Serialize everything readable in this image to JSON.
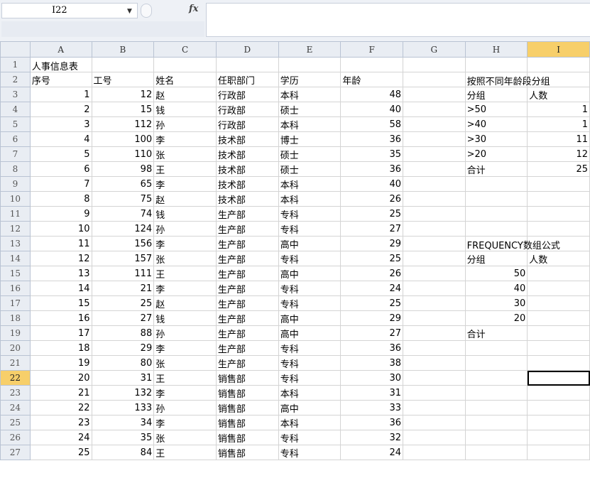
{
  "formula_bar": {
    "name_box": "I22",
    "fx": "fx",
    "formula": ""
  },
  "columns": [
    "A",
    "B",
    "C",
    "D",
    "E",
    "F",
    "G",
    "H",
    "I"
  ],
  "active_column": "I",
  "active_row": "22",
  "rows": [
    {
      "n": "1",
      "A": "人事信息表",
      "B": "",
      "C": "",
      "D": "",
      "E": "",
      "F": "",
      "G": "",
      "H": "",
      "I": ""
    },
    {
      "n": "2",
      "A": "序号",
      "B": "工号",
      "C": "姓名",
      "D": "任职部门",
      "E": "学历",
      "F": "年龄",
      "G": "",
      "H": "按照不同年龄段分组",
      "I": ""
    },
    {
      "n": "3",
      "A": "1",
      "B": "12",
      "C": "赵",
      "D": "行政部",
      "E": "本科",
      "F": "48",
      "G": "",
      "H": "分组",
      "I": "人数"
    },
    {
      "n": "4",
      "A": "2",
      "B": "15",
      "C": "钱",
      "D": "行政部",
      "E": "硕士",
      "F": "40",
      "G": "",
      "H": ">50",
      "I": "1"
    },
    {
      "n": "5",
      "A": "3",
      "B": "112",
      "C": "孙",
      "D": "行政部",
      "E": "本科",
      "F": "58",
      "G": "",
      "H": ">40",
      "I": "1"
    },
    {
      "n": "6",
      "A": "4",
      "B": "100",
      "C": "李",
      "D": "技术部",
      "E": "博士",
      "F": "36",
      "G": "",
      "H": ">30",
      "I": "11"
    },
    {
      "n": "7",
      "A": "5",
      "B": "110",
      "C": "张",
      "D": "技术部",
      "E": "硕士",
      "F": "35",
      "G": "",
      "H": ">20",
      "I": "12"
    },
    {
      "n": "8",
      "A": "6",
      "B": "98",
      "C": "王",
      "D": "技术部",
      "E": "硕士",
      "F": "36",
      "G": "",
      "H": "合计",
      "I": "25"
    },
    {
      "n": "9",
      "A": "7",
      "B": "65",
      "C": "李",
      "D": "技术部",
      "E": "本科",
      "F": "40",
      "G": "",
      "H": "",
      "I": ""
    },
    {
      "n": "10",
      "A": "8",
      "B": "75",
      "C": "赵",
      "D": "技术部",
      "E": "本科",
      "F": "26",
      "G": "",
      "H": "",
      "I": ""
    },
    {
      "n": "11",
      "A": "9",
      "B": "74",
      "C": "钱",
      "D": "生产部",
      "E": "专科",
      "F": "25",
      "G": "",
      "H": "",
      "I": ""
    },
    {
      "n": "12",
      "A": "10",
      "B": "124",
      "C": "孙",
      "D": "生产部",
      "E": "专科",
      "F": "27",
      "G": "",
      "H": "",
      "I": ""
    },
    {
      "n": "13",
      "A": "11",
      "B": "156",
      "C": "李",
      "D": "生产部",
      "E": "高中",
      "F": "29",
      "G": "",
      "H": "FREQUENCY数组公式",
      "I": ""
    },
    {
      "n": "14",
      "A": "12",
      "B": "157",
      "C": "张",
      "D": "生产部",
      "E": "专科",
      "F": "25",
      "G": "",
      "H": "分组",
      "I": "人数"
    },
    {
      "n": "15",
      "A": "13",
      "B": "111",
      "C": "王",
      "D": "生产部",
      "E": "高中",
      "F": "26",
      "G": "",
      "H": "50",
      "I": ""
    },
    {
      "n": "16",
      "A": "14",
      "B": "21",
      "C": "李",
      "D": "生产部",
      "E": "专科",
      "F": "24",
      "G": "",
      "H": "40",
      "I": ""
    },
    {
      "n": "17",
      "A": "15",
      "B": "25",
      "C": "赵",
      "D": "生产部",
      "E": "专科",
      "F": "25",
      "G": "",
      "H": "30",
      "I": ""
    },
    {
      "n": "18",
      "A": "16",
      "B": "27",
      "C": "钱",
      "D": "生产部",
      "E": "高中",
      "F": "29",
      "G": "",
      "H": "20",
      "I": ""
    },
    {
      "n": "19",
      "A": "17",
      "B": "88",
      "C": "孙",
      "D": "生产部",
      "E": "高中",
      "F": "27",
      "G": "",
      "H": "合计",
      "I": ""
    },
    {
      "n": "20",
      "A": "18",
      "B": "29",
      "C": "李",
      "D": "生产部",
      "E": "专科",
      "F": "36",
      "G": "",
      "H": "",
      "I": ""
    },
    {
      "n": "21",
      "A": "19",
      "B": "80",
      "C": "张",
      "D": "生产部",
      "E": "专科",
      "F": "38",
      "G": "",
      "H": "",
      "I": ""
    },
    {
      "n": "22",
      "A": "20",
      "B": "31",
      "C": "王",
      "D": "销售部",
      "E": "专科",
      "F": "30",
      "G": "",
      "H": "",
      "I": ""
    },
    {
      "n": "23",
      "A": "21",
      "B": "132",
      "C": "李",
      "D": "销售部",
      "E": "本科",
      "F": "31",
      "G": "",
      "H": "",
      "I": ""
    },
    {
      "n": "24",
      "A": "22",
      "B": "133",
      "C": "孙",
      "D": "销售部",
      "E": "高中",
      "F": "33",
      "G": "",
      "H": "",
      "I": ""
    },
    {
      "n": "25",
      "A": "23",
      "B": "34",
      "C": "李",
      "D": "销售部",
      "E": "本科",
      "F": "36",
      "G": "",
      "H": "",
      "I": ""
    },
    {
      "n": "26",
      "A": "24",
      "B": "35",
      "C": "张",
      "D": "销售部",
      "E": "专科",
      "F": "32",
      "G": "",
      "H": "",
      "I": ""
    },
    {
      "n": "27",
      "A": "25",
      "B": "84",
      "C": "王",
      "D": "销售部",
      "E": "专科",
      "F": "24",
      "G": "",
      "H": "",
      "I": ""
    }
  ]
}
